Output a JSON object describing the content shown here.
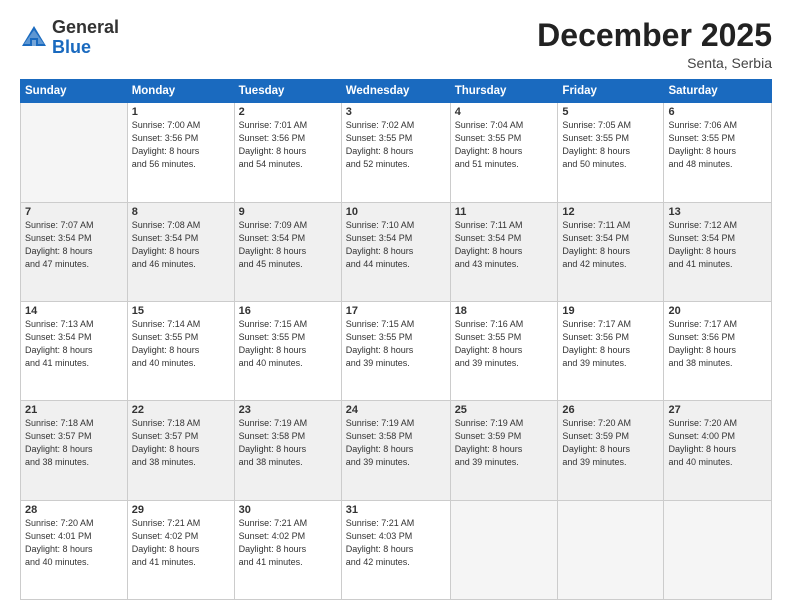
{
  "header": {
    "logo_general": "General",
    "logo_blue": "Blue",
    "month": "December 2025",
    "location": "Senta, Serbia"
  },
  "weekdays": [
    "Sunday",
    "Monday",
    "Tuesday",
    "Wednesday",
    "Thursday",
    "Friday",
    "Saturday"
  ],
  "weeks": [
    [
      {
        "day": "",
        "info": ""
      },
      {
        "day": "1",
        "info": "Sunrise: 7:00 AM\nSunset: 3:56 PM\nDaylight: 8 hours\nand 56 minutes."
      },
      {
        "day": "2",
        "info": "Sunrise: 7:01 AM\nSunset: 3:56 PM\nDaylight: 8 hours\nand 54 minutes."
      },
      {
        "day": "3",
        "info": "Sunrise: 7:02 AM\nSunset: 3:55 PM\nDaylight: 8 hours\nand 52 minutes."
      },
      {
        "day": "4",
        "info": "Sunrise: 7:04 AM\nSunset: 3:55 PM\nDaylight: 8 hours\nand 51 minutes."
      },
      {
        "day": "5",
        "info": "Sunrise: 7:05 AM\nSunset: 3:55 PM\nDaylight: 8 hours\nand 50 minutes."
      },
      {
        "day": "6",
        "info": "Sunrise: 7:06 AM\nSunset: 3:55 PM\nDaylight: 8 hours\nand 48 minutes."
      }
    ],
    [
      {
        "day": "7",
        "info": "Sunrise: 7:07 AM\nSunset: 3:54 PM\nDaylight: 8 hours\nand 47 minutes."
      },
      {
        "day": "8",
        "info": "Sunrise: 7:08 AM\nSunset: 3:54 PM\nDaylight: 8 hours\nand 46 minutes."
      },
      {
        "day": "9",
        "info": "Sunrise: 7:09 AM\nSunset: 3:54 PM\nDaylight: 8 hours\nand 45 minutes."
      },
      {
        "day": "10",
        "info": "Sunrise: 7:10 AM\nSunset: 3:54 PM\nDaylight: 8 hours\nand 44 minutes."
      },
      {
        "day": "11",
        "info": "Sunrise: 7:11 AM\nSunset: 3:54 PM\nDaylight: 8 hours\nand 43 minutes."
      },
      {
        "day": "12",
        "info": "Sunrise: 7:11 AM\nSunset: 3:54 PM\nDaylight: 8 hours\nand 42 minutes."
      },
      {
        "day": "13",
        "info": "Sunrise: 7:12 AM\nSunset: 3:54 PM\nDaylight: 8 hours\nand 41 minutes."
      }
    ],
    [
      {
        "day": "14",
        "info": "Sunrise: 7:13 AM\nSunset: 3:54 PM\nDaylight: 8 hours\nand 41 minutes."
      },
      {
        "day": "15",
        "info": "Sunrise: 7:14 AM\nSunset: 3:55 PM\nDaylight: 8 hours\nand 40 minutes."
      },
      {
        "day": "16",
        "info": "Sunrise: 7:15 AM\nSunset: 3:55 PM\nDaylight: 8 hours\nand 40 minutes."
      },
      {
        "day": "17",
        "info": "Sunrise: 7:15 AM\nSunset: 3:55 PM\nDaylight: 8 hours\nand 39 minutes."
      },
      {
        "day": "18",
        "info": "Sunrise: 7:16 AM\nSunset: 3:55 PM\nDaylight: 8 hours\nand 39 minutes."
      },
      {
        "day": "19",
        "info": "Sunrise: 7:17 AM\nSunset: 3:56 PM\nDaylight: 8 hours\nand 39 minutes."
      },
      {
        "day": "20",
        "info": "Sunrise: 7:17 AM\nSunset: 3:56 PM\nDaylight: 8 hours\nand 38 minutes."
      }
    ],
    [
      {
        "day": "21",
        "info": "Sunrise: 7:18 AM\nSunset: 3:57 PM\nDaylight: 8 hours\nand 38 minutes."
      },
      {
        "day": "22",
        "info": "Sunrise: 7:18 AM\nSunset: 3:57 PM\nDaylight: 8 hours\nand 38 minutes."
      },
      {
        "day": "23",
        "info": "Sunrise: 7:19 AM\nSunset: 3:58 PM\nDaylight: 8 hours\nand 38 minutes."
      },
      {
        "day": "24",
        "info": "Sunrise: 7:19 AM\nSunset: 3:58 PM\nDaylight: 8 hours\nand 39 minutes."
      },
      {
        "day": "25",
        "info": "Sunrise: 7:19 AM\nSunset: 3:59 PM\nDaylight: 8 hours\nand 39 minutes."
      },
      {
        "day": "26",
        "info": "Sunrise: 7:20 AM\nSunset: 3:59 PM\nDaylight: 8 hours\nand 39 minutes."
      },
      {
        "day": "27",
        "info": "Sunrise: 7:20 AM\nSunset: 4:00 PM\nDaylight: 8 hours\nand 40 minutes."
      }
    ],
    [
      {
        "day": "28",
        "info": "Sunrise: 7:20 AM\nSunset: 4:01 PM\nDaylight: 8 hours\nand 40 minutes."
      },
      {
        "day": "29",
        "info": "Sunrise: 7:21 AM\nSunset: 4:02 PM\nDaylight: 8 hours\nand 41 minutes."
      },
      {
        "day": "30",
        "info": "Sunrise: 7:21 AM\nSunset: 4:02 PM\nDaylight: 8 hours\nand 41 minutes."
      },
      {
        "day": "31",
        "info": "Sunrise: 7:21 AM\nSunset: 4:03 PM\nDaylight: 8 hours\nand 42 minutes."
      },
      {
        "day": "",
        "info": ""
      },
      {
        "day": "",
        "info": ""
      },
      {
        "day": "",
        "info": ""
      }
    ]
  ]
}
